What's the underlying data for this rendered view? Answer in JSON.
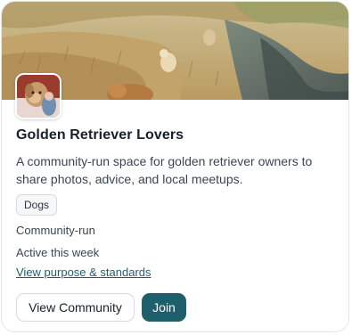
{
  "community": {
    "name": "Golden Retriever Lovers",
    "description": "A community-run space for golden retriever owners to share photos, advice, and local meetups.",
    "tag": "Dogs",
    "type": "Community-run",
    "activity": "Active this week",
    "standards_link": "View purpose & standards"
  },
  "actions": {
    "view_label": "View Community",
    "join_label": "Join"
  },
  "images": {
    "banner": "dogs-in-golden-field-photo",
    "avatar": "golden-retriever-portrait"
  },
  "colors": {
    "primary": "#1f5e6b",
    "link": "#1d5f6c",
    "title": "#17202b",
    "border": "#e3e6ea"
  }
}
